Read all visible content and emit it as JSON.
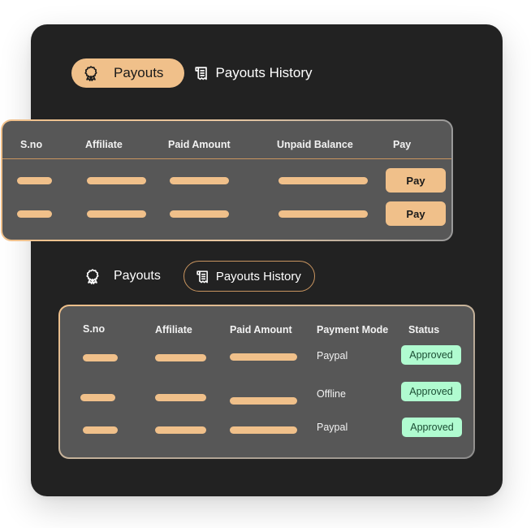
{
  "colors": {
    "accent": "#f0c08a",
    "panel_bg": "#222222",
    "card_bg": "#575757",
    "status_approved_bg": "#b0fbd0",
    "status_approved_text": "#1b4d33"
  },
  "top_section": {
    "tabs": [
      {
        "label": "Payouts",
        "icon": "award-ribbon-icon",
        "active": true
      },
      {
        "label": "Payouts History",
        "icon": "receipt-icon",
        "active": false
      }
    ],
    "table": {
      "columns": [
        "S.no",
        "Affiliate",
        "Paid Amount",
        "Unpaid Balance",
        "Pay"
      ],
      "rows": [
        {
          "sno": "",
          "affiliate": "",
          "paid_amount": "",
          "unpaid_balance": "",
          "action_label": "Pay"
        },
        {
          "sno": "",
          "affiliate": "",
          "paid_amount": "",
          "unpaid_balance": "",
          "action_label": "Pay"
        }
      ]
    }
  },
  "bottom_section": {
    "tabs": [
      {
        "label": "Payouts",
        "icon": "award-ribbon-icon",
        "active": false
      },
      {
        "label": "Payouts History",
        "icon": "receipt-icon",
        "active": true
      }
    ],
    "table": {
      "columns": [
        "S.no",
        "Affiliate",
        "Paid Amount",
        "Payment Mode",
        "Status"
      ],
      "rows": [
        {
          "sno": "",
          "affiliate": "",
          "paid_amount": "",
          "payment_mode": "Paypal",
          "status": "Approved"
        },
        {
          "sno": "",
          "affiliate": "",
          "paid_amount": "",
          "payment_mode": "Offline",
          "status": "Approved"
        },
        {
          "sno": "",
          "affiliate": "",
          "paid_amount": "",
          "payment_mode": "Paypal",
          "status": "Approved"
        }
      ]
    }
  }
}
